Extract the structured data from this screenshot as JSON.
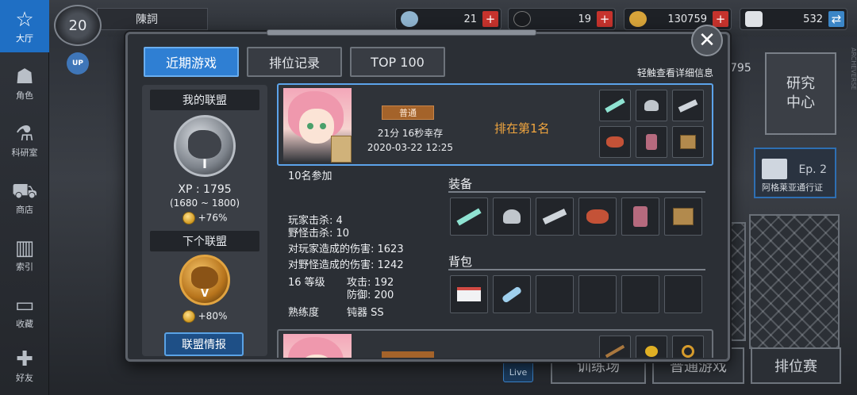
{
  "nav": [
    {
      "label": "大厅",
      "icon": "lobby-star-icon",
      "active": true
    },
    {
      "label": "角色",
      "icon": "character-icon"
    },
    {
      "label": "科研室",
      "icon": "flask-icon"
    },
    {
      "label": "商店",
      "icon": "cart-icon"
    },
    {
      "label": "索引",
      "icon": "books-icon"
    },
    {
      "label": "收藏",
      "icon": "book-open-icon"
    },
    {
      "label": "好友",
      "icon": "gamepad-icon"
    }
  ],
  "player": {
    "level": "20",
    "name": "陳詞",
    "up_label": "UP"
  },
  "resources": [
    {
      "name": "crystal",
      "value": "21"
    },
    {
      "name": "ticket",
      "value": "19"
    },
    {
      "name": "coins",
      "value": "130759"
    },
    {
      "name": "bp",
      "value": "532"
    }
  ],
  "background": {
    "research_label_1": "研究",
    "research_label_2": "中心",
    "partial_number": "795",
    "pass_ep": "Ep. 2",
    "pass_label": "阿格莱亚通行证",
    "training": "训练场",
    "normal_game": "普通游戏",
    "ranked": "排位赛",
    "live": "Live",
    "watermark": "ARCHEVERSE"
  },
  "tabs": [
    "近期游戏",
    "排位记录",
    "TOP 100"
  ],
  "hint": "轻触查看详细信息",
  "league": {
    "my_league_label": "我的联盟",
    "my_tier": "I",
    "xp": "XP : 1795",
    "xp_range": "(1680 ~ 1800)",
    "my_bonus": "+76%",
    "next_league_label": "下个联盟",
    "next_tier": "V",
    "next_bonus": "+80%",
    "info_button": "联盟情报"
  },
  "game": {
    "mode": "普通",
    "survival": "21分 16秒幸存",
    "datetime": "2020-03-22 12:25",
    "rank_text": "排在第1名",
    "participants": "10名参加",
    "player_kills": "玩家击杀: 4",
    "monster_kills": "野怪击杀: 10",
    "player_damage": "对玩家造成的伤害: 1623",
    "monster_damage": "对野怪造成的伤害: 1242",
    "level": "16 等级",
    "attack": "攻击: 192",
    "defense": "防御: 200",
    "proficiency_label": "熟练度",
    "proficiency_value": "钝器 SS",
    "equipment_title": "装备",
    "backpack_title": "背包",
    "equipment": [
      "dagger-pair-icon",
      "helmet-icon",
      "gauntlet-blade-icon",
      "scarf-icon",
      "boots-icon",
      "crate-icon"
    ],
    "backpack": [
      "first-aid-kit-icon",
      "water-bottle-icon",
      "",
      "",
      "",
      ""
    ]
  },
  "colors": {
    "accent": "#2f7fd3",
    "rank": "#f1a63f",
    "badge": "#a4632a",
    "plus": "#c6332d"
  }
}
